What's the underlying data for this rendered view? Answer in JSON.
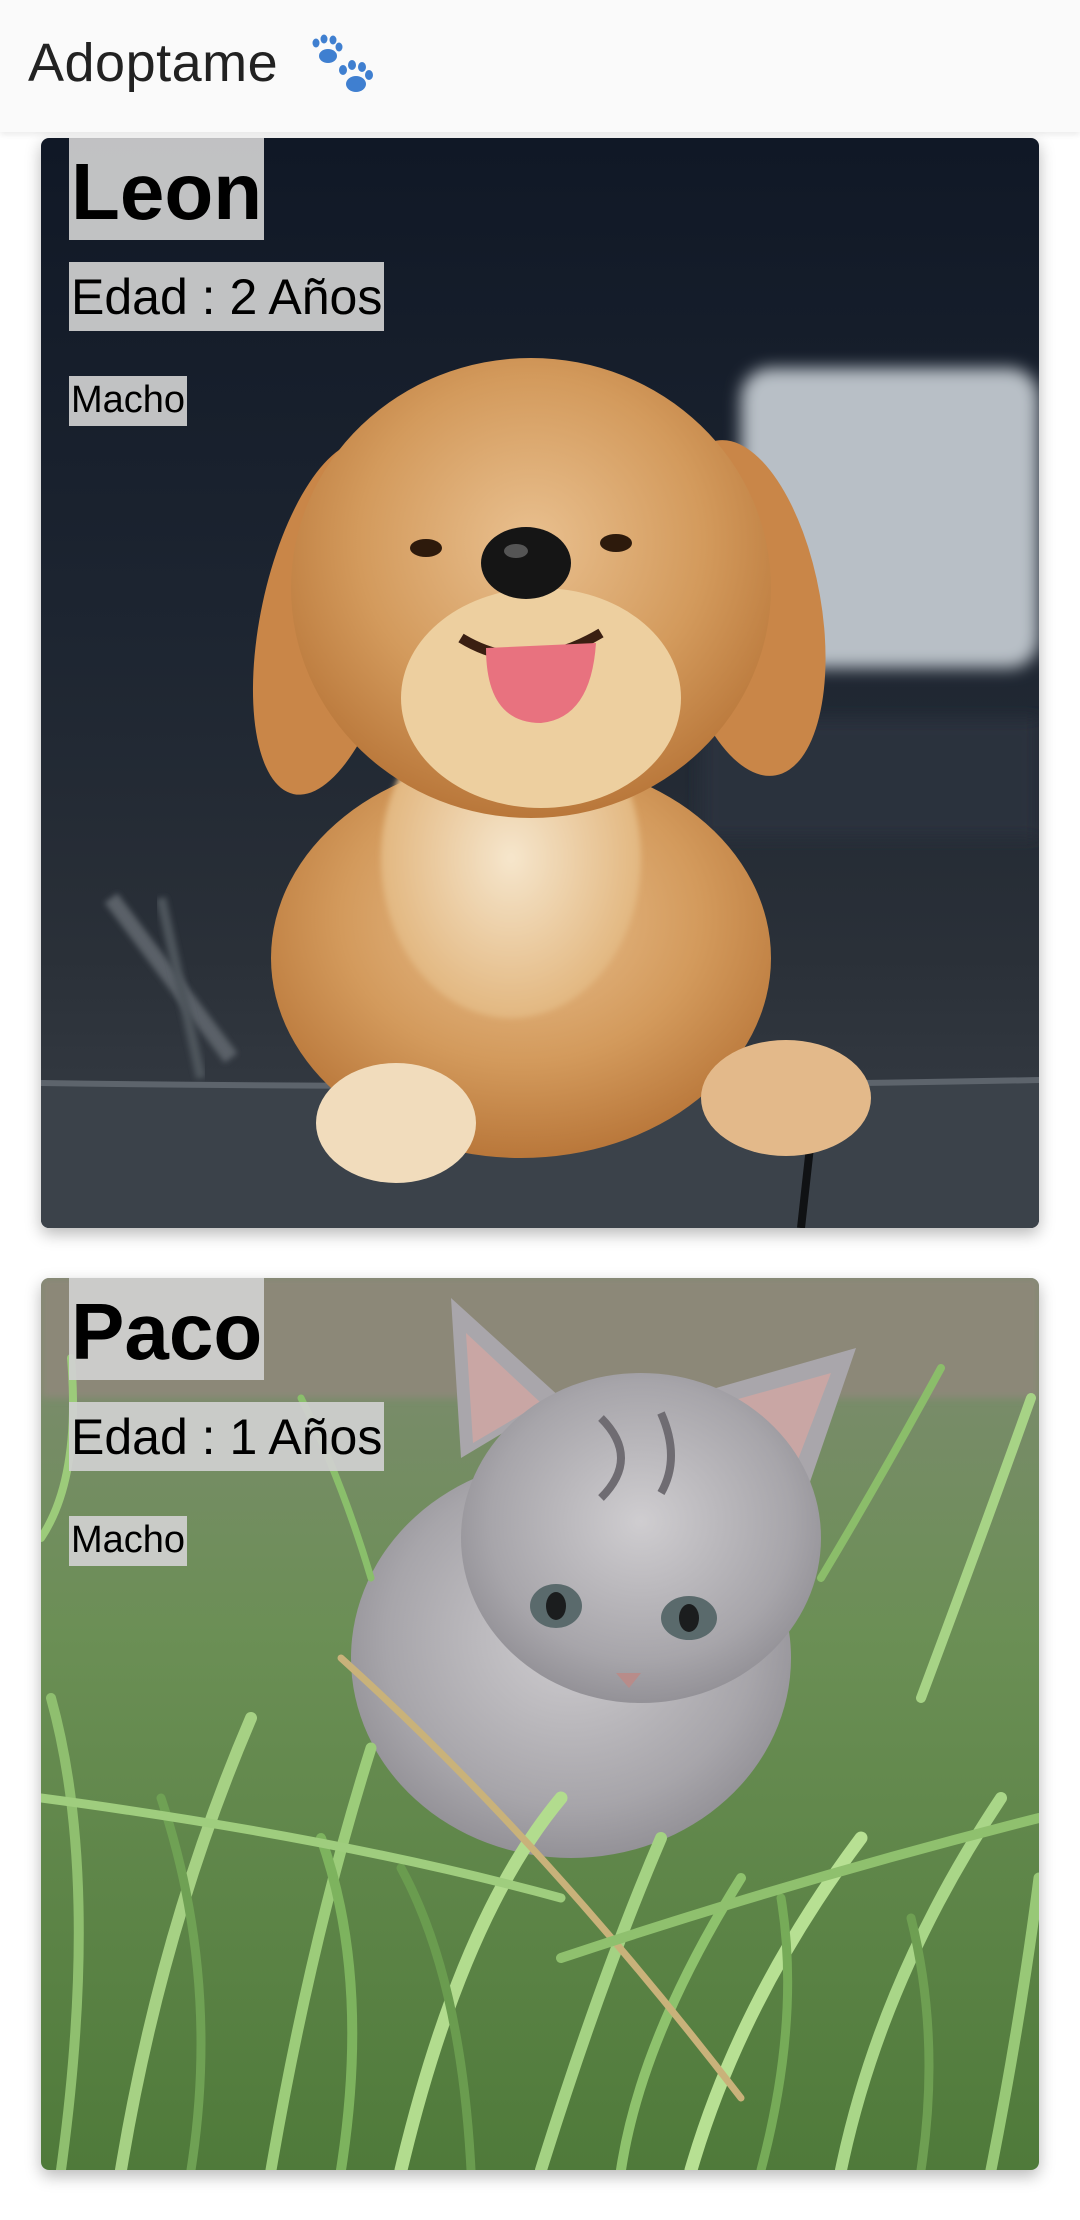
{
  "app_bar": {
    "title": "Adoptame",
    "icon": "paw-prints-icon",
    "icon_color": "#3f7fd0"
  },
  "pets": [
    {
      "name": "Leon",
      "age": "Edad : 2 Años",
      "sex": "Macho",
      "photo": "dog-photo"
    },
    {
      "name": "Paco",
      "age": "Edad : 1 Años",
      "sex": "Macho",
      "photo": "kitten-photo"
    }
  ],
  "colors": {
    "label_background": "#d0d0d0",
    "app_bar_background": "#fafafa",
    "page_background": "#ffffff"
  }
}
